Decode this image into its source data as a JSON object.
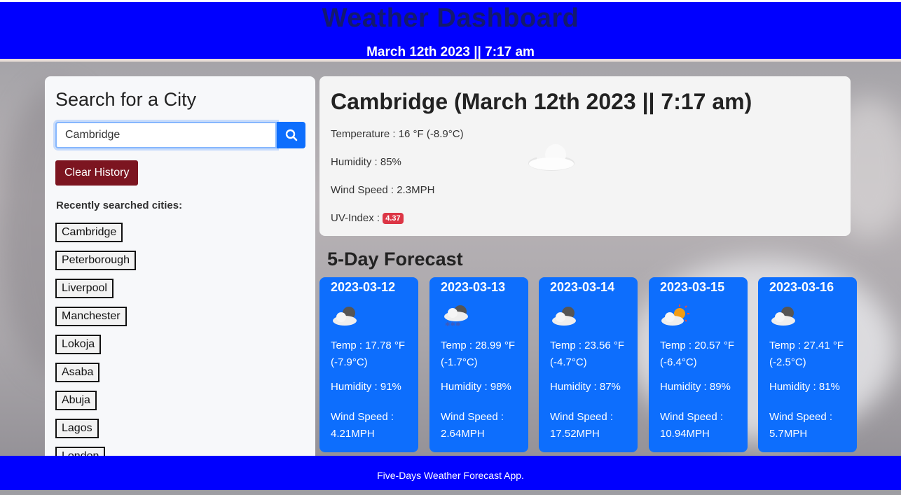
{
  "header": {
    "title": "Weather Dashboard",
    "datetime": "March 12th 2023 || 7:17 am"
  },
  "search": {
    "heading": "Search for a City",
    "value": "Cambridge",
    "button_icon": "search-icon",
    "clear_label": "Clear History",
    "recent_label": "Recently searched cities:",
    "cities": [
      "Cambridge",
      "Peterborough",
      "Liverpool",
      "Manchester",
      "Lokoja",
      "Asaba",
      "Abuja",
      "Lagos",
      "London"
    ]
  },
  "current": {
    "heading": "Cambridge (March 12th 2023 || 7:17 am)",
    "temperature": "Temperature : 16 °F (-8.9°C)",
    "humidity": "Humidity : 85%",
    "wind": "Wind Speed : 2.3MPH",
    "uv_label": "UV-Index :",
    "uv_value": "4.37",
    "icon": "cloud-icon"
  },
  "forecast": {
    "title": "5-Day Forecast",
    "days": [
      {
        "date": "2023-03-12",
        "icon": "cloud-icon",
        "temp": "Temp : 17.78 °F (-7.9°C)",
        "humidity": "Humidity : 91%",
        "wind": "Wind Speed : 4.21MPH"
      },
      {
        "date": "2023-03-13",
        "icon": "snow-icon",
        "temp": "Temp : 28.99 °F (-1.7°C)",
        "humidity": "Humidity : 98%",
        "wind": "Wind Speed : 2.64MPH"
      },
      {
        "date": "2023-03-14",
        "icon": "cloud-icon",
        "temp": "Temp : 23.56 °F (-4.7°C)",
        "humidity": "Humidity : 87%",
        "wind": "Wind Speed : 17.52MPH"
      },
      {
        "date": "2023-03-15",
        "icon": "partly-cloudy-icon",
        "temp": "Temp : 20.57 °F (-6.4°C)",
        "humidity": "Humidity : 89%",
        "wind": "Wind Speed : 10.94MPH"
      },
      {
        "date": "2023-03-16",
        "icon": "cloud-icon",
        "temp": "Temp : 27.41 °F (-2.5°C)",
        "humidity": "Humidity : 81%",
        "wind": "Wind Speed : 5.7MPH"
      }
    ]
  },
  "footer": {
    "text": "Five-Days Weather Forecast App."
  },
  "colors": {
    "header": "#0000ff",
    "accent": "#0d6efd",
    "danger": "#dc3545",
    "clear": "#7c1520"
  }
}
